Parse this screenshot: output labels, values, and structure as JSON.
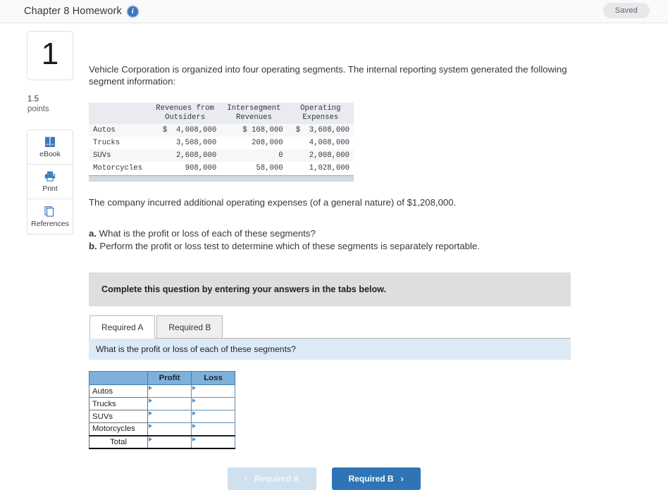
{
  "header": {
    "title": "Chapter 8 Homework",
    "info_icon": "info-icon",
    "saved_label": "Saved"
  },
  "rail": {
    "question_number": "1",
    "points_value": "1.5",
    "points_label": "points",
    "tools": [
      {
        "label": "eBook",
        "icon": "ebook-icon"
      },
      {
        "label": "Print",
        "icon": "printer-icon"
      },
      {
        "label": "References",
        "icon": "references-icon"
      }
    ]
  },
  "question": {
    "intro": "Vehicle Corporation is organized into four operating segments. The internal reporting system generated the following segment information:",
    "note": "The company incurred additional operating expenses (of a general nature) of $1,208,000.",
    "requirements": [
      {
        "letter": "a.",
        "text": "What is the profit or loss of each of these segments?"
      },
      {
        "letter": "b.",
        "text": "Perform the profit or loss test to determine which of these segments is separately reportable."
      }
    ]
  },
  "segment_table": {
    "headers": [
      "",
      "Revenues from Outsiders",
      "Intersegment Revenues",
      "Operating Expenses"
    ],
    "header_lines": [
      [
        "",
        ""
      ],
      [
        "Revenues from",
        "Outsiders"
      ],
      [
        "Intersegment",
        "Revenues"
      ],
      [
        "Operating",
        "Expenses"
      ]
    ],
    "rows": [
      {
        "label": "Autos",
        "revenues_outsiders": "$  4,008,000",
        "intersegment": "$ 108,000",
        "operating_expenses": "$  3,608,000"
      },
      {
        "label": "Trucks",
        "revenues_outsiders": "3,508,000",
        "intersegment": "208,000",
        "operating_expenses": "4,008,000"
      },
      {
        "label": "SUVs",
        "revenues_outsiders": "2,608,000",
        "intersegment": "0",
        "operating_expenses": "2,008,000"
      },
      {
        "label": "Motorcycles",
        "revenues_outsiders": "908,000",
        "intersegment": "58,000",
        "operating_expenses": "1,028,000"
      }
    ]
  },
  "banner": {
    "text": "Complete this question by entering your answers in the tabs below."
  },
  "tabs": [
    {
      "label": "Required A",
      "state": "active"
    },
    {
      "label": "Required B",
      "state": "inactive"
    }
  ],
  "prompt": {
    "text": "What is the profit or loss of each of these segments?"
  },
  "answer_table": {
    "headers": [
      "",
      "Profit",
      "Loss"
    ],
    "rows": [
      {
        "label": "Autos",
        "profit": "",
        "loss": ""
      },
      {
        "label": "Trucks",
        "profit": "",
        "loss": ""
      },
      {
        "label": "SUVs",
        "profit": "",
        "loss": ""
      },
      {
        "label": "Motorcycles",
        "profit": "",
        "loss": ""
      },
      {
        "label": "Total",
        "profit": "",
        "loss": ""
      }
    ]
  },
  "nav": {
    "prev_label": "Required A",
    "prev_chevron": "‹",
    "next_label": "Required B",
    "next_chevron": "›"
  },
  "colors": {
    "accent_blue": "#2f74b5",
    "table_header_blue": "#7eb0dc",
    "prompt_blue": "#ddeaf6",
    "banner_gray": "#dedede",
    "saved_gray": "#e8e8ea"
  }
}
